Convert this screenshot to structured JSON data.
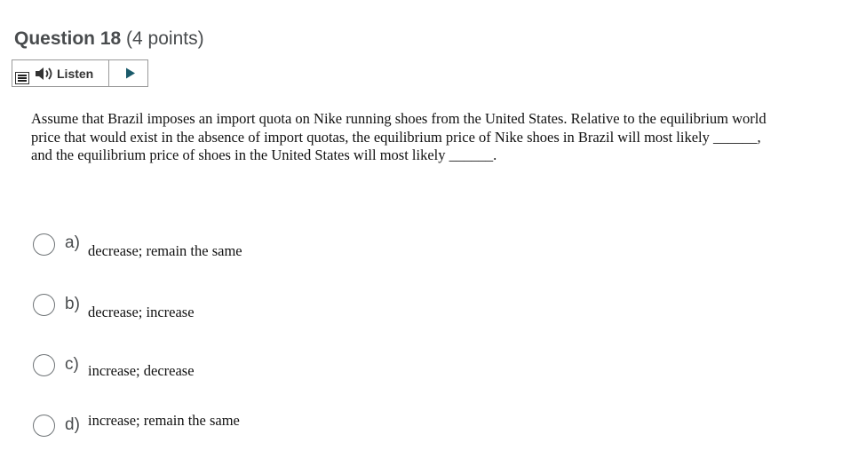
{
  "question": {
    "title": "Question 18",
    "points": "(4 points)",
    "text": "Assume that Brazil imposes an import quota on Nike running shoes from the United States. Relative to the equilibrium world price that would exist in the absence of import quotas, the equilibrium price of Nike shoes in Brazil will most likely ______, and the equilibrium price of shoes in the United States will most likely ______."
  },
  "listen_toolbar": {
    "listen_label": "Listen",
    "icons": [
      "menu-icon",
      "speaker-icon",
      "play-icon"
    ]
  },
  "options": [
    {
      "letter": "a)",
      "text": "decrease; remain the same",
      "selected": false
    },
    {
      "letter": "b)",
      "text": "decrease; increase",
      "selected": false
    },
    {
      "letter": "c)",
      "text": "increase; decrease",
      "selected": false
    },
    {
      "letter": "d)",
      "text": "increase; remain the same",
      "selected": false
    }
  ]
}
